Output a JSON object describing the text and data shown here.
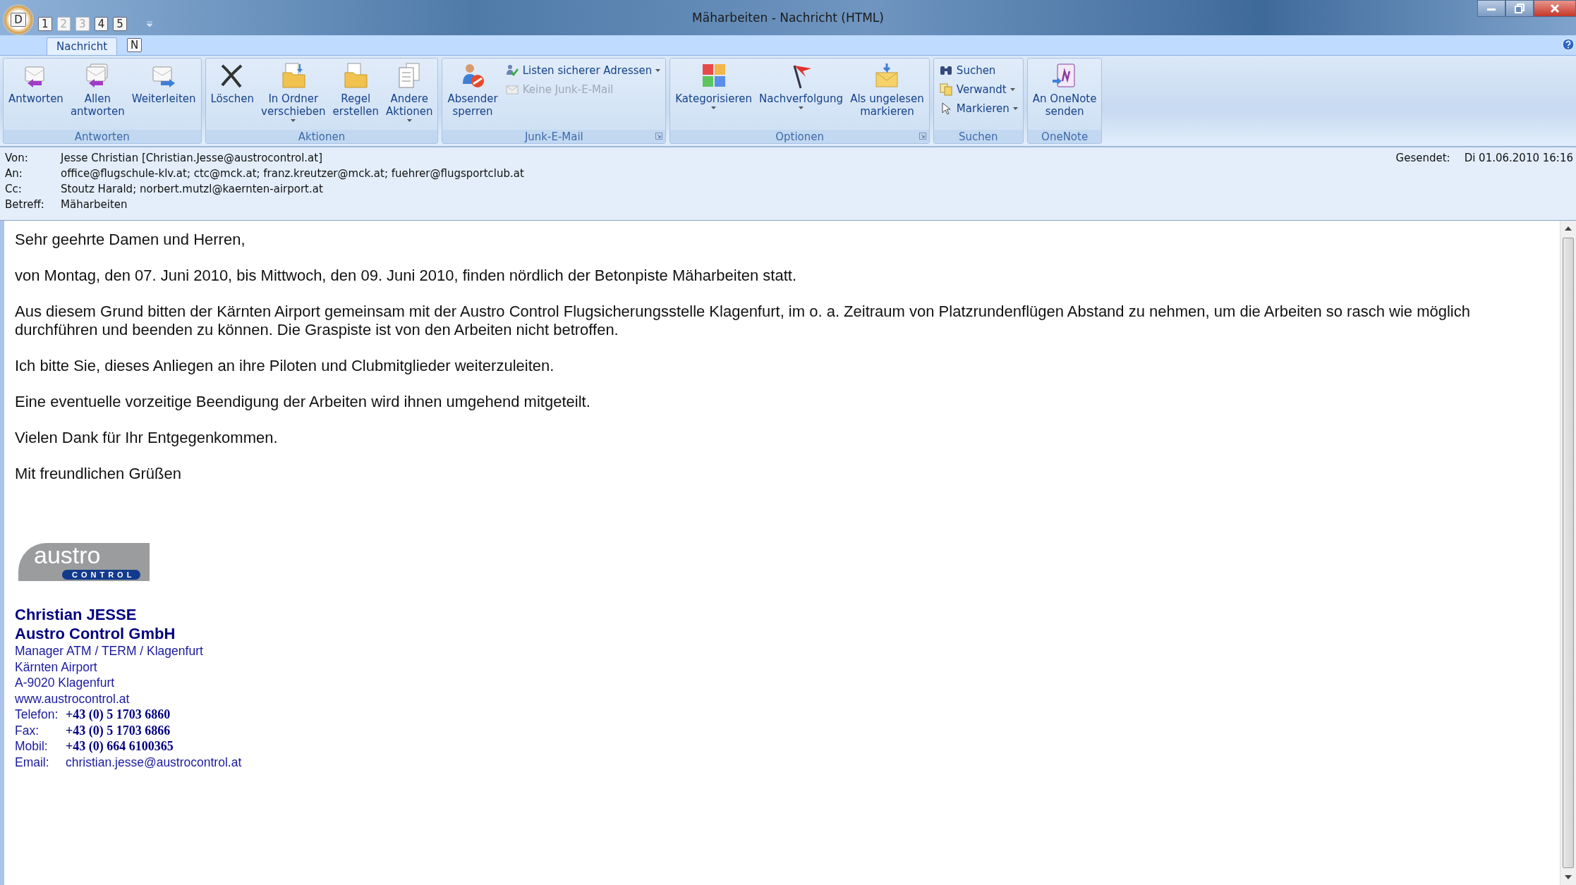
{
  "window": {
    "title": "Mäharbeiten - Nachricht (HTML)",
    "office_key": "D",
    "quick_access": [
      {
        "key": "1",
        "disabled": false
      },
      {
        "key": "2",
        "disabled": true
      },
      {
        "key": "3",
        "disabled": true
      },
      {
        "key": "4",
        "disabled": false
      },
      {
        "key": "5",
        "disabled": false
      }
    ]
  },
  "tabs": [
    {
      "label": "Nachricht",
      "selected": true,
      "key_tip": "N"
    }
  ],
  "ribbon": {
    "groups": [
      {
        "label": "Antworten",
        "launcher": false,
        "items": [
          {
            "kind": "large",
            "lines": [
              "Antworten"
            ],
            "dropdown": false,
            "disabled": false
          },
          {
            "kind": "large",
            "lines": [
              "Allen",
              "antworten"
            ],
            "dropdown": false,
            "disabled": false
          },
          {
            "kind": "large",
            "lines": [
              "Weiterleiten"
            ],
            "dropdown": false,
            "disabled": false
          }
        ]
      },
      {
        "label": "Aktionen",
        "launcher": false,
        "items": [
          {
            "kind": "large",
            "lines": [
              "Löschen"
            ],
            "dropdown": false,
            "disabled": false
          },
          {
            "kind": "large",
            "lines": [
              "In Ordner",
              "verschieben"
            ],
            "dropdown": true,
            "disabled": false
          },
          {
            "kind": "large",
            "lines": [
              "Regel",
              "erstellen"
            ],
            "dropdown": false,
            "disabled": false
          },
          {
            "kind": "large",
            "lines": [
              "Andere",
              "Aktionen"
            ],
            "dropdown": true,
            "disabled": false
          }
        ]
      },
      {
        "label": "Junk-E-Mail",
        "launcher": true,
        "items": [
          {
            "kind": "large",
            "lines": [
              "Absender",
              "sperren"
            ],
            "dropdown": false,
            "disabled": false
          },
          {
            "kind": "small",
            "lines": [
              "Listen sicherer Adressen"
            ],
            "dropdown": true,
            "disabled": false
          },
          {
            "kind": "small",
            "lines": [
              "Keine Junk-E-Mail"
            ],
            "dropdown": false,
            "disabled": true
          }
        ]
      },
      {
        "label": "Optionen",
        "launcher": true,
        "items": [
          {
            "kind": "large",
            "lines": [
              "Kategorisieren"
            ],
            "dropdown": true,
            "disabled": false
          },
          {
            "kind": "large",
            "lines": [
              "Nachverfolgung"
            ],
            "dropdown": true,
            "disabled": false
          },
          {
            "kind": "large",
            "lines": [
              "Als ungelesen",
              "markieren"
            ],
            "dropdown": false,
            "disabled": false
          }
        ]
      },
      {
        "label": "Suchen",
        "launcher": false,
        "items": [
          {
            "kind": "small",
            "lines": [
              "Suchen"
            ],
            "dropdown": false,
            "disabled": false
          },
          {
            "kind": "small",
            "lines": [
              "Verwandt"
            ],
            "dropdown": true,
            "disabled": false
          },
          {
            "kind": "small",
            "lines": [
              "Markieren"
            ],
            "dropdown": true,
            "disabled": false
          }
        ]
      },
      {
        "label": "OneNote",
        "launcher": false,
        "items": [
          {
            "kind": "large",
            "lines": [
              "An OneNote",
              "senden"
            ],
            "dropdown": false,
            "disabled": false
          }
        ]
      }
    ]
  },
  "header": {
    "fields": [
      {
        "label": "Von:",
        "value": "Jesse Christian [Christian.Jesse@austrocontrol.at]"
      },
      {
        "label": "An:",
        "value": "office@flugschule-klv.at; ctc@mck.at; franz.kreutzer@mck.at; fuehrer@flugsportclub.at"
      },
      {
        "label": "Cc:",
        "value": "Stoutz Harald; norbert.mutzl@kaernten-airport.at"
      },
      {
        "label": "Betreff:",
        "value": "Mäharbeiten"
      }
    ],
    "sent": {
      "label": "Gesendet:",
      "value": "Di 01.06.2010 16:16"
    }
  },
  "body": {
    "paragraphs": [
      "Sehr geehrte Damen und Herren,",
      "von Montag, den 07. Juni 2010, bis Mittwoch, den 09. Juni 2010, finden nördlich der Betonpiste Mäharbeiten statt.",
      "Aus diesem Grund bitten der Kärnten Airport gemeinsam mit der Austro Control Flugsicherungsstelle Klagenfurt, im o. a. Zeitraum von Platzrundenflügen Abstand zu nehmen, um die Arbeiten so rasch wie möglich durchführen und beenden zu können. Die Graspiste ist von den Arbeiten nicht betroffen.",
      "Ich bitte Sie, dieses Anliegen an ihre Piloten und Clubmitglieder weiterzuleiten.",
      "Eine eventuelle vorzeitige Beendigung der Arbeiten wird ihnen umgehend mitgeteilt.",
      "Vielen Dank für Ihr Entgegenkommen.",
      "Mit freundlichen Grüßen"
    ],
    "signature": {
      "logo": {
        "word": "austro",
        "sub": "CONTROL"
      },
      "headings": [
        "Christian JESSE",
        "Austro Control GmbH"
      ],
      "lines": [
        "Manager ATM / TERM / Klagenfurt",
        "Kärnten Airport",
        "A-9020 Klagenfurt",
        "www.austrocontrol.at"
      ],
      "contacts": [
        {
          "label": "Telefon:",
          "value": "+43 (0) 5 1703 6860",
          "kind": "phone"
        },
        {
          "label": "Fax:",
          "value": "+43 (0) 5 1703 6866",
          "kind": "phone"
        },
        {
          "label": "Mobil:",
          "value": "+43 (0) 664  6100365",
          "kind": "phone"
        },
        {
          "label": "Email:",
          "value": "christian.jesse@austrocontrol.at",
          "kind": "email"
        }
      ]
    }
  }
}
